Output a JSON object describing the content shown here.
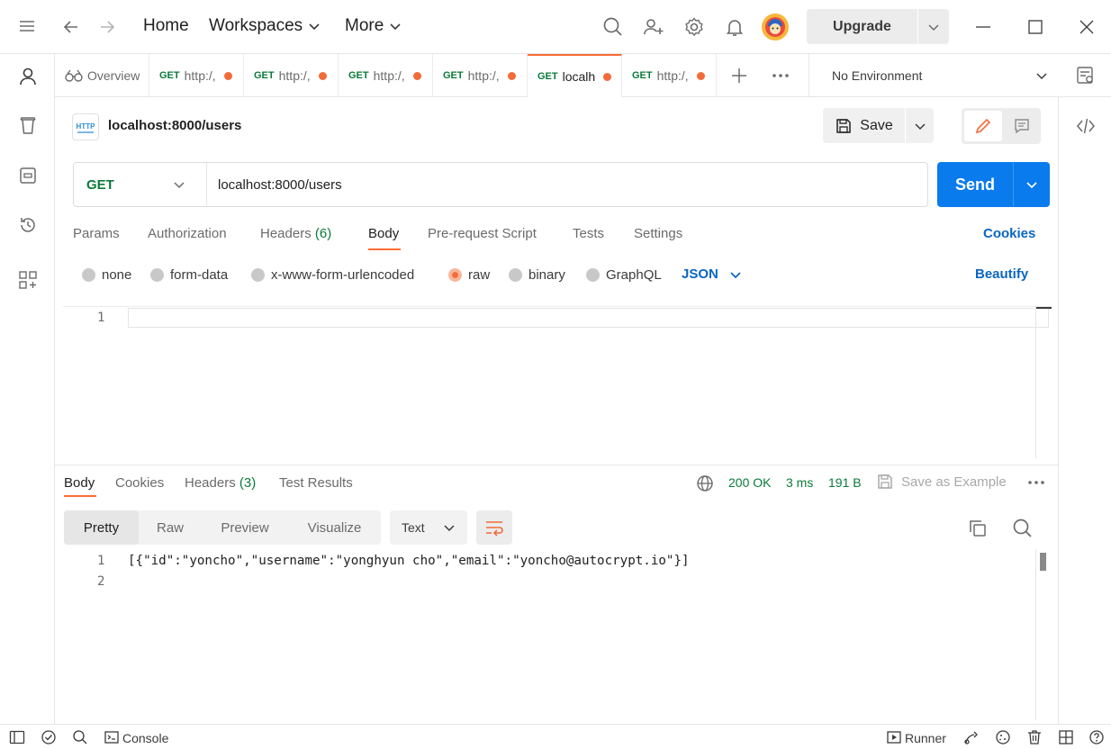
{
  "titlebar": {
    "nav_home": "Home",
    "nav_workspaces": "Workspaces",
    "nav_more": "More",
    "upgrade_label": "Upgrade"
  },
  "tabs": [
    {
      "method": "",
      "label": "Overview",
      "type": "overview"
    },
    {
      "method": "GET",
      "label": "http:/,",
      "dirty": true
    },
    {
      "method": "GET",
      "label": "http:/,",
      "dirty": true
    },
    {
      "method": "GET",
      "label": "http:/,",
      "dirty": true
    },
    {
      "method": "GET",
      "label": "http:/,",
      "dirty": true
    },
    {
      "method": "GET",
      "label": "localh",
      "dirty": true,
      "active": true
    },
    {
      "method": "GET",
      "label": "http:/,",
      "dirty": true
    }
  ],
  "environment": {
    "selected": "No Environment"
  },
  "request": {
    "title": "localhost:8000/users",
    "save_label": "Save",
    "method": "GET",
    "url": "localhost:8000/users",
    "send_label": "Send",
    "tabs": {
      "params": "Params",
      "authorization": "Authorization",
      "headers": "Headers",
      "headers_count": "(6)",
      "body": "Body",
      "prerequest": "Pre-request Script",
      "tests": "Tests",
      "settings": "Settings"
    },
    "cookies_link": "Cookies",
    "body_types": {
      "none": "none",
      "form_data": "form-data",
      "urlencoded": "x-www-form-urlencoded",
      "raw": "raw",
      "binary": "binary",
      "graphql": "GraphQL"
    },
    "selected_body_type": "raw",
    "raw_format": "JSON",
    "beautify_label": "Beautify",
    "editor_line": "1"
  },
  "response": {
    "tabs": {
      "body": "Body",
      "cookies": "Cookies",
      "headers": "Headers",
      "headers_count": "(3)",
      "test_results": "Test Results"
    },
    "status": "200 OK",
    "time": "3 ms",
    "size": "191 B",
    "save_example": "Save as Example",
    "views": {
      "pretty": "Pretty",
      "raw": "Raw",
      "preview": "Preview",
      "visualize": "Visualize"
    },
    "format": "Text",
    "lines": [
      {
        "num": "1",
        "text": "[{\"id\":\"yoncho\",\"username\":\"yonghyun cho\",\"email\":\"yoncho@autocrypt.io\"}]"
      },
      {
        "num": "2",
        "text": ""
      }
    ]
  },
  "statusbar": {
    "console": "Console",
    "runner": "Runner"
  },
  "colors": {
    "accent": "#ff6c37",
    "send": "#097bed",
    "method_get": "#0b7a3b",
    "link": "#0a66c2"
  }
}
